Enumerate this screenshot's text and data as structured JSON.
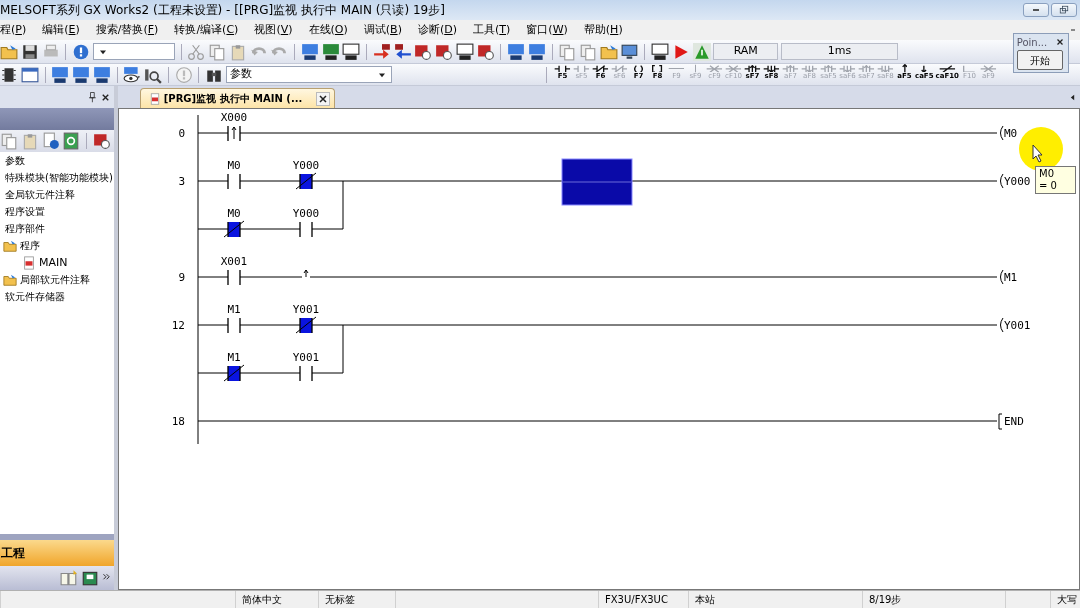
{
  "window": {
    "title": "MELSOFT系列 GX Works2 (工程未设置) - [[PRG]监视 执行中 MAIN (只读) 19步]"
  },
  "menu": [
    "程(P)",
    "编辑(E)",
    "搜索/替换(F)",
    "转换/编译(C)",
    "视图(V)",
    "在线(O)",
    "调试(B)",
    "诊断(D)",
    "工具(T)",
    "窗口(W)",
    "帮助(H)"
  ],
  "toolbar": {
    "monitor_fields": [
      "RAM",
      "1ms"
    ],
    "search_combo": {
      "value": "参数"
    },
    "function_keys": [
      {
        "label": "F5",
        "kind": "no",
        "disabled": false
      },
      {
        "label": "sF5",
        "kind": "no",
        "disabled": true
      },
      {
        "label": "F6",
        "kind": "nc",
        "disabled": false
      },
      {
        "label": "sF6",
        "kind": "nc",
        "disabled": true
      },
      {
        "label": "F7",
        "kind": "coil",
        "disabled": false
      },
      {
        "label": "F8",
        "kind": "func",
        "disabled": false
      },
      {
        "label": "F9",
        "kind": "hline",
        "disabled": true
      },
      {
        "label": "sF9",
        "kind": "vline",
        "disabled": true
      },
      {
        "label": "cF9",
        "kind": "xline",
        "disabled": true
      },
      {
        "label": "cF10",
        "kind": "xline",
        "disabled": true
      },
      {
        "label": "sF7",
        "kind": "rise",
        "disabled": false
      },
      {
        "label": "sF8",
        "kind": "fall",
        "disabled": false
      },
      {
        "label": "aF7",
        "kind": "rise",
        "disabled": true
      },
      {
        "label": "aF8",
        "kind": "fall",
        "disabled": true
      },
      {
        "label": "saF5",
        "kind": "rise",
        "disabled": true
      },
      {
        "label": "saF6",
        "kind": "fall",
        "disabled": true
      },
      {
        "label": "saF7",
        "kind": "rise",
        "disabled": true
      },
      {
        "label": "saF8",
        "kind": "fall",
        "disabled": true
      },
      {
        "label": "aF5",
        "kind": "up",
        "disabled": false
      },
      {
        "label": "caF5",
        "kind": "down",
        "disabled": false
      },
      {
        "label": "caF10",
        "kind": "inv",
        "disabled": false
      },
      {
        "label": "F10",
        "kind": "corner",
        "disabled": true
      },
      {
        "label": "aF9",
        "kind": "xline",
        "disabled": true
      }
    ]
  },
  "point_window": {
    "title": "Poin...",
    "button": "开始"
  },
  "navigation": {
    "tree": [
      {
        "label": "参数"
      },
      {
        "label": "特殊模块(智能功能模块)"
      },
      {
        "label": "全局软元件注释"
      },
      {
        "label": "程序设置"
      },
      {
        "label": "程序部件",
        "children": [
          {
            "label": "程序",
            "kind": "folder",
            "children": [
              {
                "label": "MAIN",
                "kind": "program"
              }
            ]
          },
          {
            "label": "局部软元件注释",
            "kind": "folder"
          }
        ]
      },
      {
        "label": "软元件存储器"
      }
    ],
    "section_button": "工程"
  },
  "editor": {
    "tab": {
      "title": "[PRG]监视 执行中 MAIN (...",
      "selected": true
    },
    "rungs": [
      {
        "step": "0",
        "rows": [
          {
            "contacts": [
              {
                "kind": "rise",
                "label": "X000",
                "on": false
              }
            ]
          }
        ],
        "coil": {
          "kind": "out",
          "label": "M0"
        }
      },
      {
        "step": "3",
        "cursor": true,
        "rows": [
          {
            "contacts": [
              {
                "kind": "no",
                "label": "M0",
                "on": false
              },
              {
                "kind": "nc",
                "label": "Y000",
                "on": true
              }
            ]
          },
          {
            "contacts": [
              {
                "kind": "nc",
                "label": "M0",
                "on": true
              },
              {
                "kind": "no",
                "label": "Y000",
                "on": false
              }
            ]
          }
        ],
        "coil": {
          "kind": "out",
          "label": "Y000"
        }
      },
      {
        "step": "9",
        "rows": [
          {
            "contacts": [
              {
                "kind": "no",
                "label": "X001",
                "on": false
              },
              {
                "kind": "mep",
                "on": false
              }
            ]
          }
        ],
        "coil": {
          "kind": "out",
          "label": "M1"
        }
      },
      {
        "step": "12",
        "rows": [
          {
            "contacts": [
              {
                "kind": "no",
                "label": "M1",
                "on": false
              },
              {
                "kind": "nc",
                "label": "Y001",
                "on": true
              }
            ]
          },
          {
            "contacts": [
              {
                "kind": "nc",
                "label": "M1",
                "on": true
              },
              {
                "kind": "no",
                "label": "Y001",
                "on": false
              }
            ]
          }
        ],
        "coil": {
          "kind": "out",
          "label": "Y001"
        }
      },
      {
        "step": "18",
        "rows": [
          {
            "contacts": []
          }
        ],
        "coil": {
          "kind": "end",
          "label": "END"
        }
      }
    ],
    "tooltip": [
      "M0",
      "= 0"
    ]
  },
  "status_bar": [
    {
      "text": "简体中文"
    },
    {
      "text": "无标签"
    },
    {
      "text": "FX3U/FX3UC"
    },
    {
      "text": "本站"
    },
    {
      "text": "8/19步"
    },
    {
      "text": "大写"
    }
  ]
}
